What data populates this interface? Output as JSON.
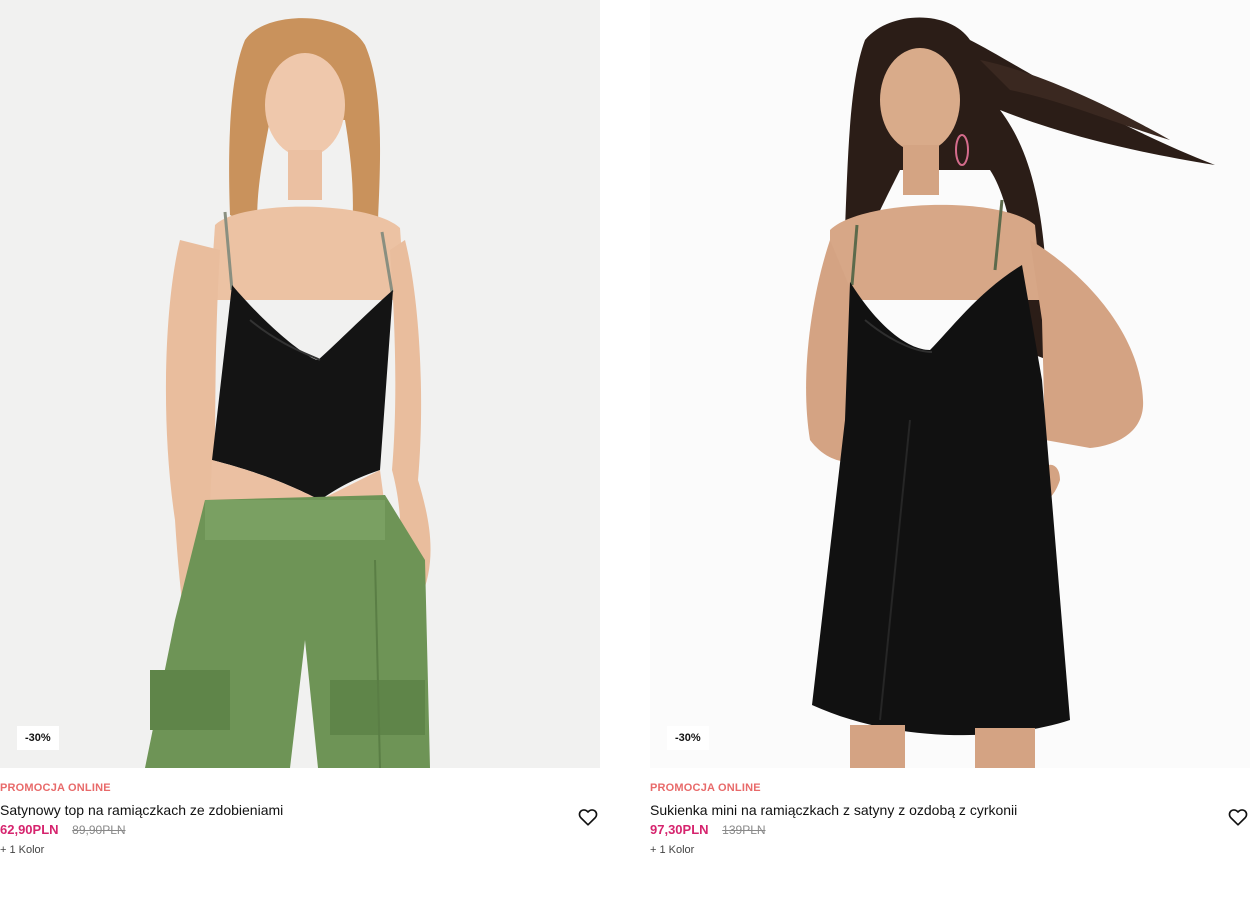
{
  "products": [
    {
      "badge": "-30%",
      "promo_label": "PROMOCJA ONLINE",
      "title": "Satynowy top na ramiączkach ze zdobieniami",
      "price": "62,90PLN",
      "old_price": "89,90PLN",
      "colors": "+ 1 Kolor",
      "wishlist_icon": "heart-icon"
    },
    {
      "badge": "-30%",
      "promo_label": "PROMOCJA ONLINE",
      "title": "Sukienka mini na ramiączkach z satyny z ozdobą z cyrkonii",
      "price": "97,30PLN",
      "old_price": "139PLN",
      "colors": "+ 1 Kolor",
      "wishlist_icon": "heart-icon"
    }
  ],
  "colors": {
    "promo": "#e86a6a",
    "sale_price": "#d6246e",
    "old_price": "#8a8a8a"
  }
}
